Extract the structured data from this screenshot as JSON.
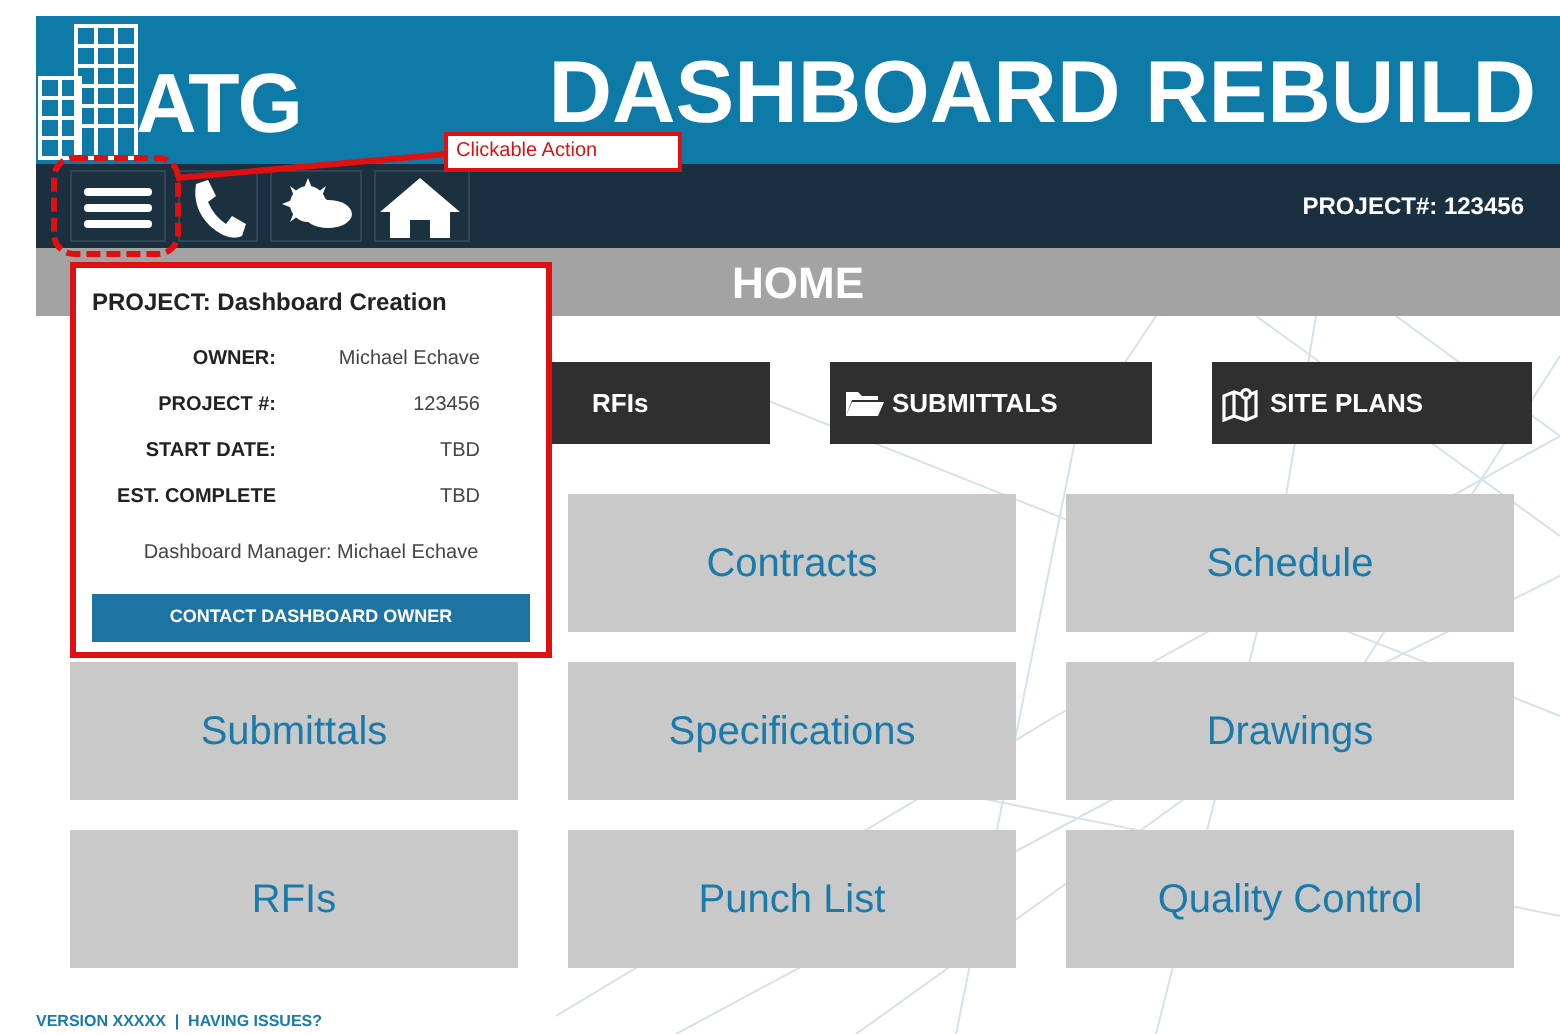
{
  "header": {
    "logo": "ATG",
    "title": "DASHBOARD REBUILD"
  },
  "toolbar": {
    "icons": [
      {
        "kind": "menu"
      },
      {
        "kind": "phone"
      },
      {
        "kind": "weather"
      },
      {
        "kind": "home"
      }
    ],
    "project_number": "PROJECT#: 123456"
  },
  "page_title": "HOME",
  "quick_links": [
    {
      "label": "RFIs",
      "kind": "plain"
    },
    {
      "label": "SUBMITTALS",
      "kind": "folder"
    },
    {
      "label": "SITE PLANS",
      "kind": "map"
    }
  ],
  "tiles": [
    {
      "label": "Contracts"
    },
    {
      "label": "Schedule"
    },
    {
      "label": "Submittals"
    },
    {
      "label": "Specifications"
    },
    {
      "label": "Drawings"
    },
    {
      "label": "RFIs"
    },
    {
      "label": "Punch List"
    },
    {
      "label": "Quality Control"
    }
  ],
  "project_popup": {
    "title": "PROJECT: Dashboard Creation",
    "fields": [
      {
        "label": "OWNER:",
        "value": "Michael Echave"
      },
      {
        "label": "PROJECT #:",
        "value": "123456"
      },
      {
        "label": "START DATE:",
        "value": "TBD"
      },
      {
        "label": "EST. COMPLETE",
        "value": "TBD"
      }
    ],
    "manager": "Dashboard Manager: Michael Echave",
    "button": "CONTACT DASHBOARD OWNER"
  },
  "annotation": {
    "label": "Clickable Action"
  },
  "footer": {
    "text": "VERSION XXXXX  |  HAVING ISSUES?"
  }
}
